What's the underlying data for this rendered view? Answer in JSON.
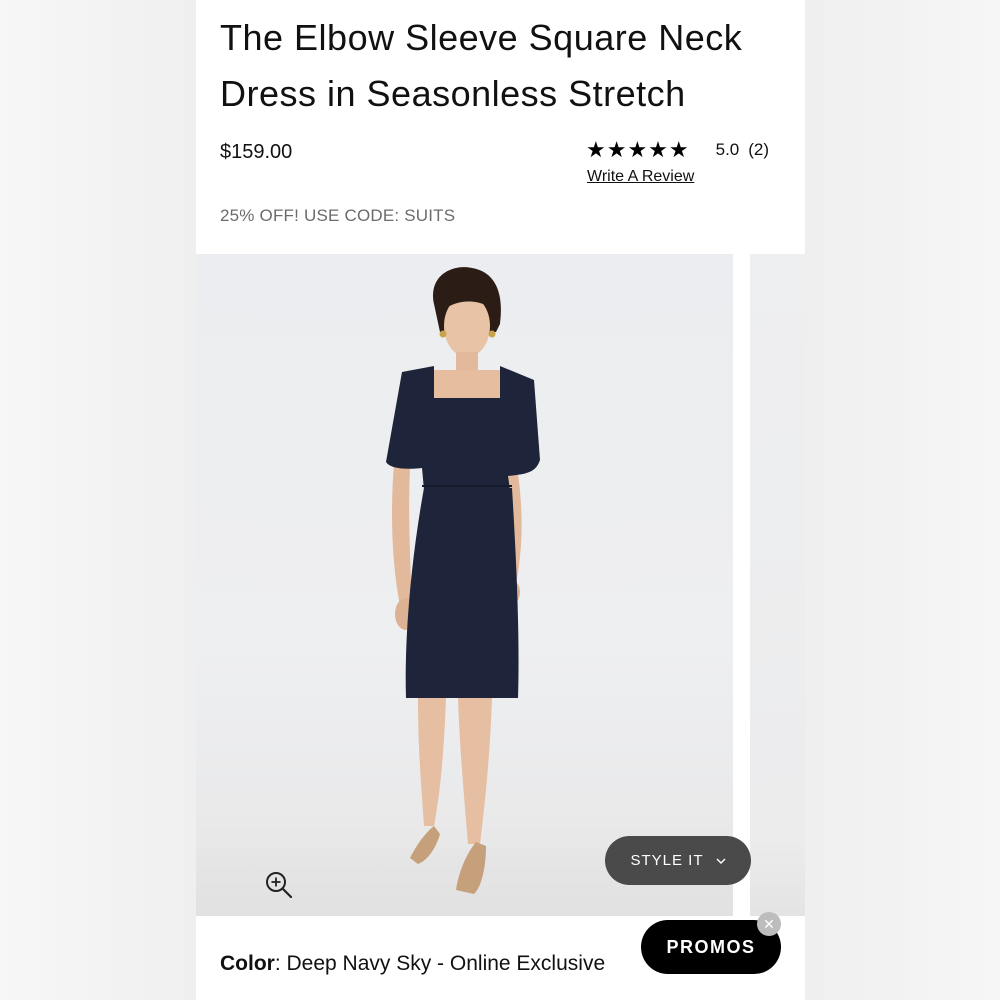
{
  "product": {
    "title": "The Elbow Sleeve Square Neck Dress in Seasonless Stretch",
    "price": "$159.00",
    "rating": {
      "stars": "★★★★★",
      "value": "5.0",
      "count": "(2)",
      "score": 5.0,
      "max": 5
    },
    "write_review_label": "Write A Review",
    "promo_text": "25% OFF! USE CODE: SUITS"
  },
  "gallery": {
    "style_it_label": "STYLE IT",
    "zoom_icon": "zoom-in-icon",
    "chevron_icon": "chevron-down-icon"
  },
  "color": {
    "label": "Color",
    "value": "Deep Navy Sky - Online Exclusive"
  },
  "promos": {
    "label": "PROMOS",
    "close_icon": "close-icon"
  },
  "colors": {
    "dress": "#1e2439",
    "style_it_bg": "#4a4a4a",
    "promos_bg": "#000000",
    "promo_text": "#6b6b6b"
  }
}
